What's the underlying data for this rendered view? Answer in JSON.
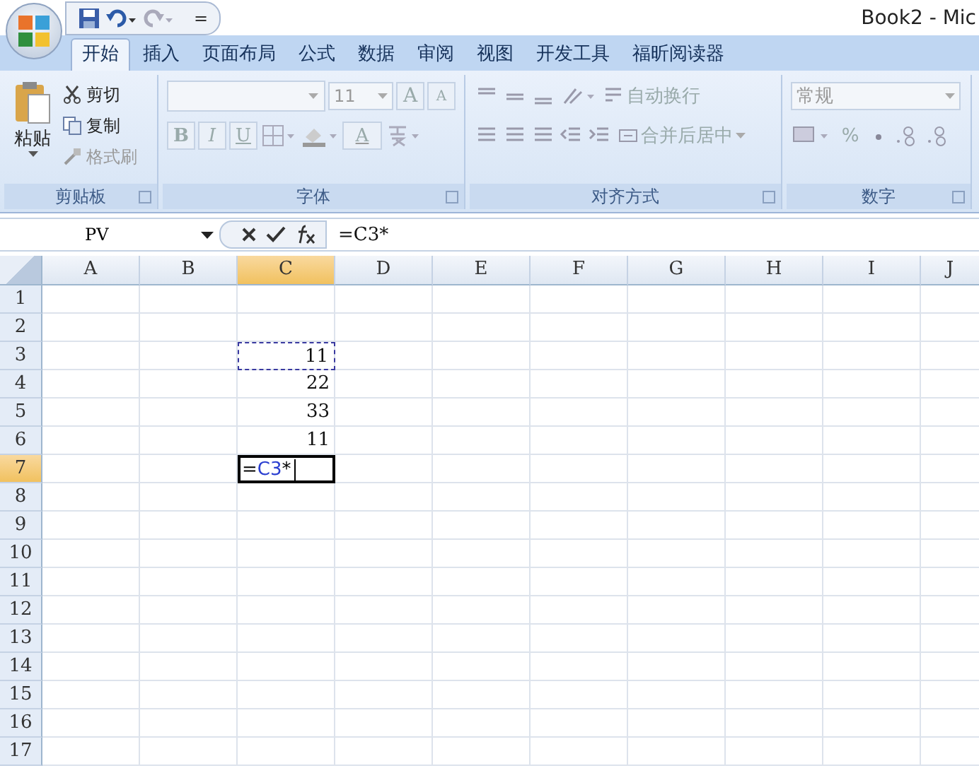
{
  "window": {
    "title": "Book2 - Mic"
  },
  "quick_access": {
    "separator": "="
  },
  "tabs": [
    {
      "label": "开始",
      "selected": true
    },
    {
      "label": "插入",
      "selected": false
    },
    {
      "label": "页面布局",
      "selected": false
    },
    {
      "label": "公式",
      "selected": false
    },
    {
      "label": "数据",
      "selected": false
    },
    {
      "label": "审阅",
      "selected": false
    },
    {
      "label": "视图",
      "selected": false
    },
    {
      "label": "开发工具",
      "selected": false
    },
    {
      "label": "福昕阅读器",
      "selected": false
    }
  ],
  "clipboard_group": {
    "label": "剪贴板",
    "paste": {
      "label": "粘贴"
    },
    "items": [
      {
        "label": "剪切",
        "kind": "cut",
        "disabled": false
      },
      {
        "label": "复制",
        "kind": "copy",
        "disabled": false
      },
      {
        "label": "格式刷",
        "kind": "painter",
        "disabled": true
      }
    ]
  },
  "font_group": {
    "label": "字体",
    "disabled": true,
    "size": "11",
    "grow": "A",
    "shrink": "A",
    "bold": "B",
    "italic": "I",
    "underline": "U",
    "color_letter": "A"
  },
  "alignment_group": {
    "label": "对齐方式",
    "disabled": true,
    "wrap": "自动换行",
    "merge": "合并后居中"
  },
  "number_group": {
    "label": "数字",
    "disabled": true,
    "format": "常规",
    "percent": "%"
  },
  "formula_bar": {
    "name_box": "PV",
    "formula": "=C3*"
  },
  "columns": [
    {
      "label": "A",
      "selected": false
    },
    {
      "label": "B",
      "selected": false
    },
    {
      "label": "C",
      "selected": true
    },
    {
      "label": "D",
      "selected": false
    },
    {
      "label": "E",
      "selected": false
    },
    {
      "label": "F",
      "selected": false
    },
    {
      "label": "G",
      "selected": false
    },
    {
      "label": "H",
      "selected": false
    },
    {
      "label": "I",
      "selected": false
    },
    {
      "label": "J",
      "selected": false
    }
  ],
  "rows": [
    {
      "label": "1",
      "selected": false
    },
    {
      "label": "2",
      "selected": false
    },
    {
      "label": "3",
      "selected": false,
      "cells": [
        {},
        {},
        {
          "value": "11",
          "marquee": true
        }
      ]
    },
    {
      "label": "4",
      "selected": false,
      "cells": [
        {},
        {},
        {
          "value": "22",
          "marquee": false
        }
      ]
    },
    {
      "label": "5",
      "selected": false,
      "cells": [
        {},
        {},
        {
          "value": "33",
          "marquee": false
        }
      ]
    },
    {
      "label": "6",
      "selected": false,
      "cells": [
        {},
        {},
        {
          "value": "11",
          "marquee": false
        }
      ]
    },
    {
      "label": "7",
      "selected": true,
      "cells": [
        {},
        {},
        {
          "kind": "editing",
          "parts": [
            {
              "text": "=",
              "kind": "plain"
            },
            {
              "text": "C3",
              "kind": "reference"
            },
            {
              "text": "*",
              "kind": "plain"
            }
          ]
        }
      ]
    },
    {
      "label": "8",
      "selected": false
    },
    {
      "label": "9",
      "selected": false
    },
    {
      "label": "10",
      "selected": false
    },
    {
      "label": "11",
      "selected": false
    },
    {
      "label": "12",
      "selected": false
    },
    {
      "label": "13",
      "selected": false
    },
    {
      "label": "14",
      "selected": false
    },
    {
      "label": "15",
      "selected": false
    },
    {
      "label": "16",
      "selected": false
    },
    {
      "label": "17",
      "selected": false
    }
  ]
}
